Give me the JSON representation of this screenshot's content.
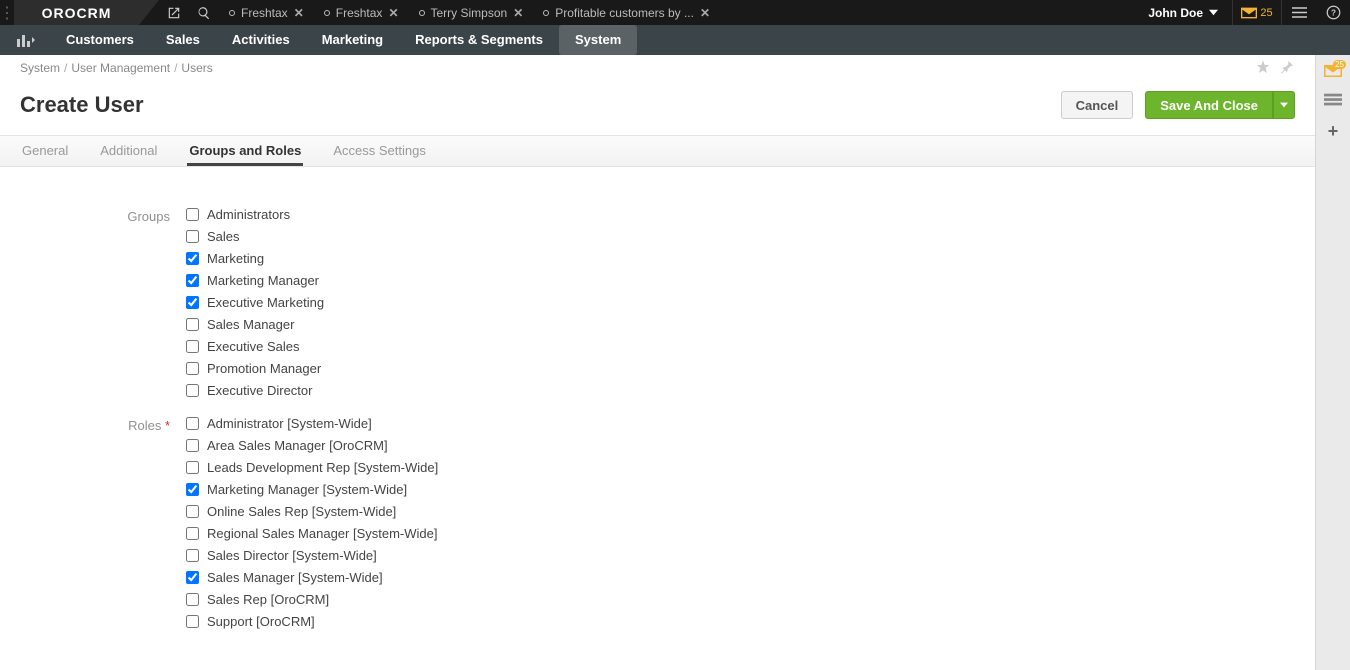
{
  "top": {
    "logo": "OROCRM",
    "tabs": [
      {
        "label": "Freshtax"
      },
      {
        "label": "Freshtax"
      },
      {
        "label": "Terry Simpson"
      },
      {
        "label": "Profitable customers by ..."
      }
    ],
    "user": "John Doe",
    "mail_count": "25"
  },
  "nav": {
    "items": [
      "Customers",
      "Sales",
      "Activities",
      "Marketing",
      "Reports & Segments",
      "System"
    ],
    "active": 5
  },
  "breadcrumb": [
    "System",
    "User Management",
    "Users"
  ],
  "page_title": "Create User",
  "buttons": {
    "cancel": "Cancel",
    "save": "Save And Close"
  },
  "tabs": {
    "items": [
      "General",
      "Additional",
      "Groups and Roles",
      "Access Settings"
    ],
    "active": 2
  },
  "form": {
    "groups_label": "Groups",
    "groups": [
      {
        "label": "Administrators",
        "checked": false
      },
      {
        "label": "Sales",
        "checked": false
      },
      {
        "label": "Marketing",
        "checked": true
      },
      {
        "label": "Marketing Manager",
        "checked": true
      },
      {
        "label": "Executive Marketing",
        "checked": true
      },
      {
        "label": "Sales Manager",
        "checked": false
      },
      {
        "label": "Executive Sales",
        "checked": false
      },
      {
        "label": "Promotion Manager",
        "checked": false
      },
      {
        "label": "Executive Director",
        "checked": false
      }
    ],
    "roles_label": "Roles",
    "roles_required": true,
    "roles": [
      {
        "label": "Administrator [System-Wide]",
        "checked": false
      },
      {
        "label": "Area Sales Manager [OroCRM]",
        "checked": false
      },
      {
        "label": "Leads Development Rep [System-Wide]",
        "checked": false
      },
      {
        "label": "Marketing Manager [System-Wide]",
        "checked": true
      },
      {
        "label": "Online Sales Rep [System-Wide]",
        "checked": false
      },
      {
        "label": "Regional Sales Manager [System-Wide]",
        "checked": false
      },
      {
        "label": "Sales Director [System-Wide]",
        "checked": false
      },
      {
        "label": "Sales Manager [System-Wide]",
        "checked": true
      },
      {
        "label": "Sales Rep [OroCRM]",
        "checked": false
      },
      {
        "label": "Support [OroCRM]",
        "checked": false
      }
    ]
  }
}
